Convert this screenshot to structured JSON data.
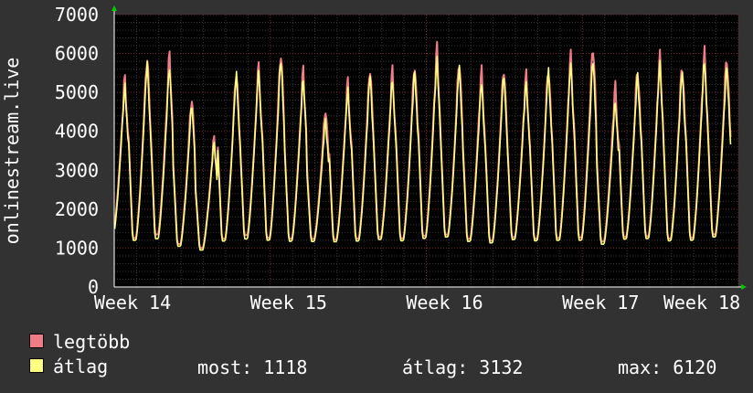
{
  "chart_data": {
    "type": "line",
    "ylabel": "onlinestream.live",
    "ylim": [
      0,
      7000
    ],
    "yticks": [
      0,
      1000,
      2000,
      3000,
      4000,
      5000,
      6000,
      7000
    ],
    "xticks": [
      "Week 14",
      "Week 15",
      "Week 16",
      "Week 17",
      "Week 18"
    ],
    "days": 28,
    "series": [
      {
        "name": "legtöbb",
        "color": "#f07c86",
        "peaks": [
          5500,
          6100,
          6100,
          5000,
          3900,
          5700,
          5800,
          6200,
          5700,
          4700,
          5400,
          5800,
          5700,
          5900,
          6300,
          6000,
          5700,
          5800,
          5600,
          5800,
          6100,
          6400,
          5300,
          5800,
          6100,
          5900,
          6200,
          6100
        ],
        "troughs": [
          1200,
          1000,
          1100,
          900,
          850,
          1000,
          1100,
          1000,
          1000,
          1050,
          1000,
          1000,
          1050,
          1000,
          1050,
          1100,
          1000,
          950,
          1050,
          1000,
          1000,
          1000,
          950,
          1050,
          1050,
          1000,
          1000,
          1100
        ]
      },
      {
        "name": "átlag",
        "color": "#ffff80",
        "peaks": [
          5300,
          5900,
          5800,
          4800,
          3800,
          5600,
          5700,
          6000,
          5500,
          4400,
          5200,
          5600,
          5500,
          5700,
          6000,
          5800,
          5400,
          5600,
          5400,
          5700,
          5900,
          6000,
          4900,
          5600,
          5900,
          5700,
          6000,
          5800
        ],
        "troughs": [
          1100,
          950,
          1000,
          850,
          800,
          950,
          1000,
          950,
          950,
          1000,
          950,
          950,
          1000,
          950,
          1000,
          1050,
          950,
          900,
          1000,
          950,
          950,
          950,
          900,
          1000,
          1000,
          950,
          950,
          1050
        ]
      }
    ],
    "grid": true
  },
  "legend": {
    "max_label": "legtöbb",
    "avg_label": "átlag",
    "now": "most: 1118",
    "avg": "átlag: 3132",
    "max": "max: 6120"
  }
}
